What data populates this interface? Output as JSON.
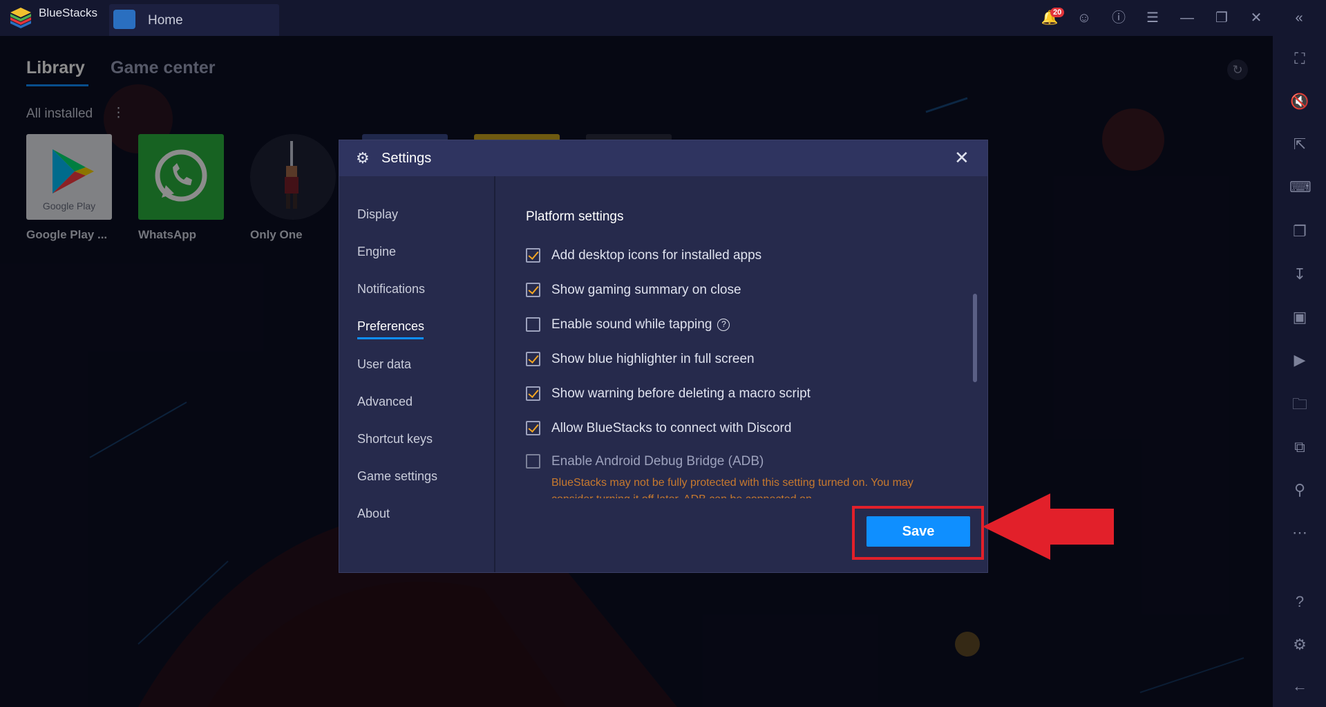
{
  "titlebar": {
    "app_name": "BlueStacks",
    "tab_label": "Home",
    "notification_count": "20"
  },
  "library": {
    "tabs": [
      "Library",
      "Game center"
    ],
    "active_tab": "Library",
    "section_label": "All installed",
    "apps": [
      {
        "name": "Google Play ...",
        "tile_text": "Google Play"
      },
      {
        "name": "WhatsApp"
      },
      {
        "name": "Only One"
      }
    ]
  },
  "settings": {
    "title": "Settings",
    "nav": [
      "Display",
      "Engine",
      "Notifications",
      "Preferences",
      "User data",
      "Advanced",
      "Shortcut keys",
      "Game settings",
      "About"
    ],
    "active_nav": "Preferences",
    "section_title": "Platform settings",
    "options": [
      {
        "label": "Add desktop icons for installed apps",
        "checked": true
      },
      {
        "label": "Show gaming summary on close",
        "checked": true
      },
      {
        "label": "Enable sound while tapping",
        "checked": false,
        "help": "?"
      },
      {
        "label": "Show blue highlighter in full screen",
        "checked": true
      },
      {
        "label": "Show warning before deleting a macro script",
        "checked": true
      },
      {
        "label": "Allow BlueStacks to connect with Discord",
        "checked": true
      },
      {
        "label": "Enable Android Debug Bridge (ADB)",
        "checked": false
      }
    ],
    "adb_warning": "BlueStacks may not be fully protected with this setting turned on. You may consider turning it off later. ADB can be connected on",
    "save_label": "Save"
  },
  "colors": {
    "accent": "#0f8fff",
    "check": "#f5a623",
    "highlight": "#e2202a",
    "warning": "#d9822b"
  }
}
